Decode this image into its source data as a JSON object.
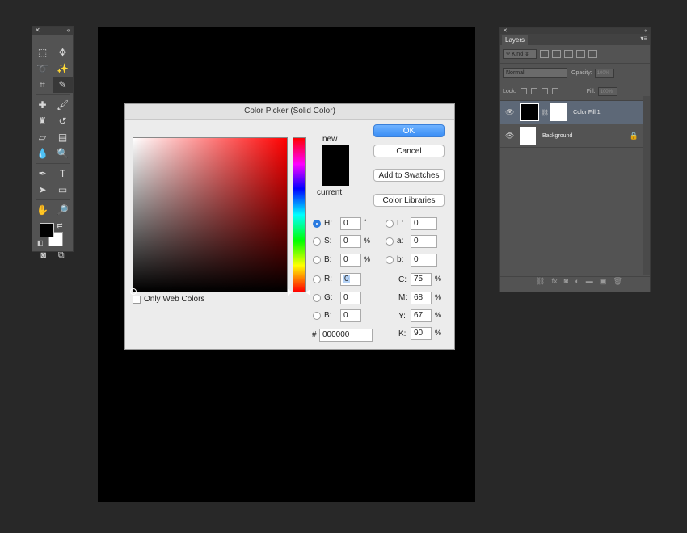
{
  "dialog": {
    "title": "Color Picker (Solid Color)",
    "new_label": "new",
    "current_label": "current",
    "buttons": {
      "ok": "OK",
      "cancel": "Cancel",
      "add_swatches": "Add to Swatches",
      "libraries": "Color Libraries"
    },
    "only_web_colors": "Only Web Colors",
    "hsb": [
      {
        "label": "H:",
        "value": "0",
        "unit": "°",
        "selected": true
      },
      {
        "label": "S:",
        "value": "0",
        "unit": "%"
      },
      {
        "label": "B:",
        "value": "0",
        "unit": "%"
      }
    ],
    "rgb": [
      {
        "label": "R:",
        "value": "0"
      },
      {
        "label": "G:",
        "value": "0"
      },
      {
        "label": "B:",
        "value": "0"
      }
    ],
    "lab": [
      {
        "label": "L:",
        "value": "0"
      },
      {
        "label": "a:",
        "value": "0"
      },
      {
        "label": "b:",
        "value": "0"
      }
    ],
    "cmyk": [
      {
        "label": "C:",
        "value": "75",
        "unit": "%"
      },
      {
        "label": "M:",
        "value": "68",
        "unit": "%"
      },
      {
        "label": "Y:",
        "value": "67",
        "unit": "%"
      },
      {
        "label": "K:",
        "value": "90",
        "unit": "%"
      }
    ],
    "hex_label": "#",
    "hex_value": "000000",
    "new_color": "#000000",
    "current_color": "#000000"
  },
  "layers": {
    "tab": "Layers",
    "filter": "Kind",
    "blend_mode": "Normal",
    "opacity_label": "Opacity:",
    "opacity_value": "100%",
    "lock_label": "Lock:",
    "fill_label": "Fill:",
    "fill_value": "100%",
    "items": [
      {
        "name": "Color Fill 1",
        "selected": true
      },
      {
        "name": "Background",
        "locked": true
      }
    ]
  }
}
